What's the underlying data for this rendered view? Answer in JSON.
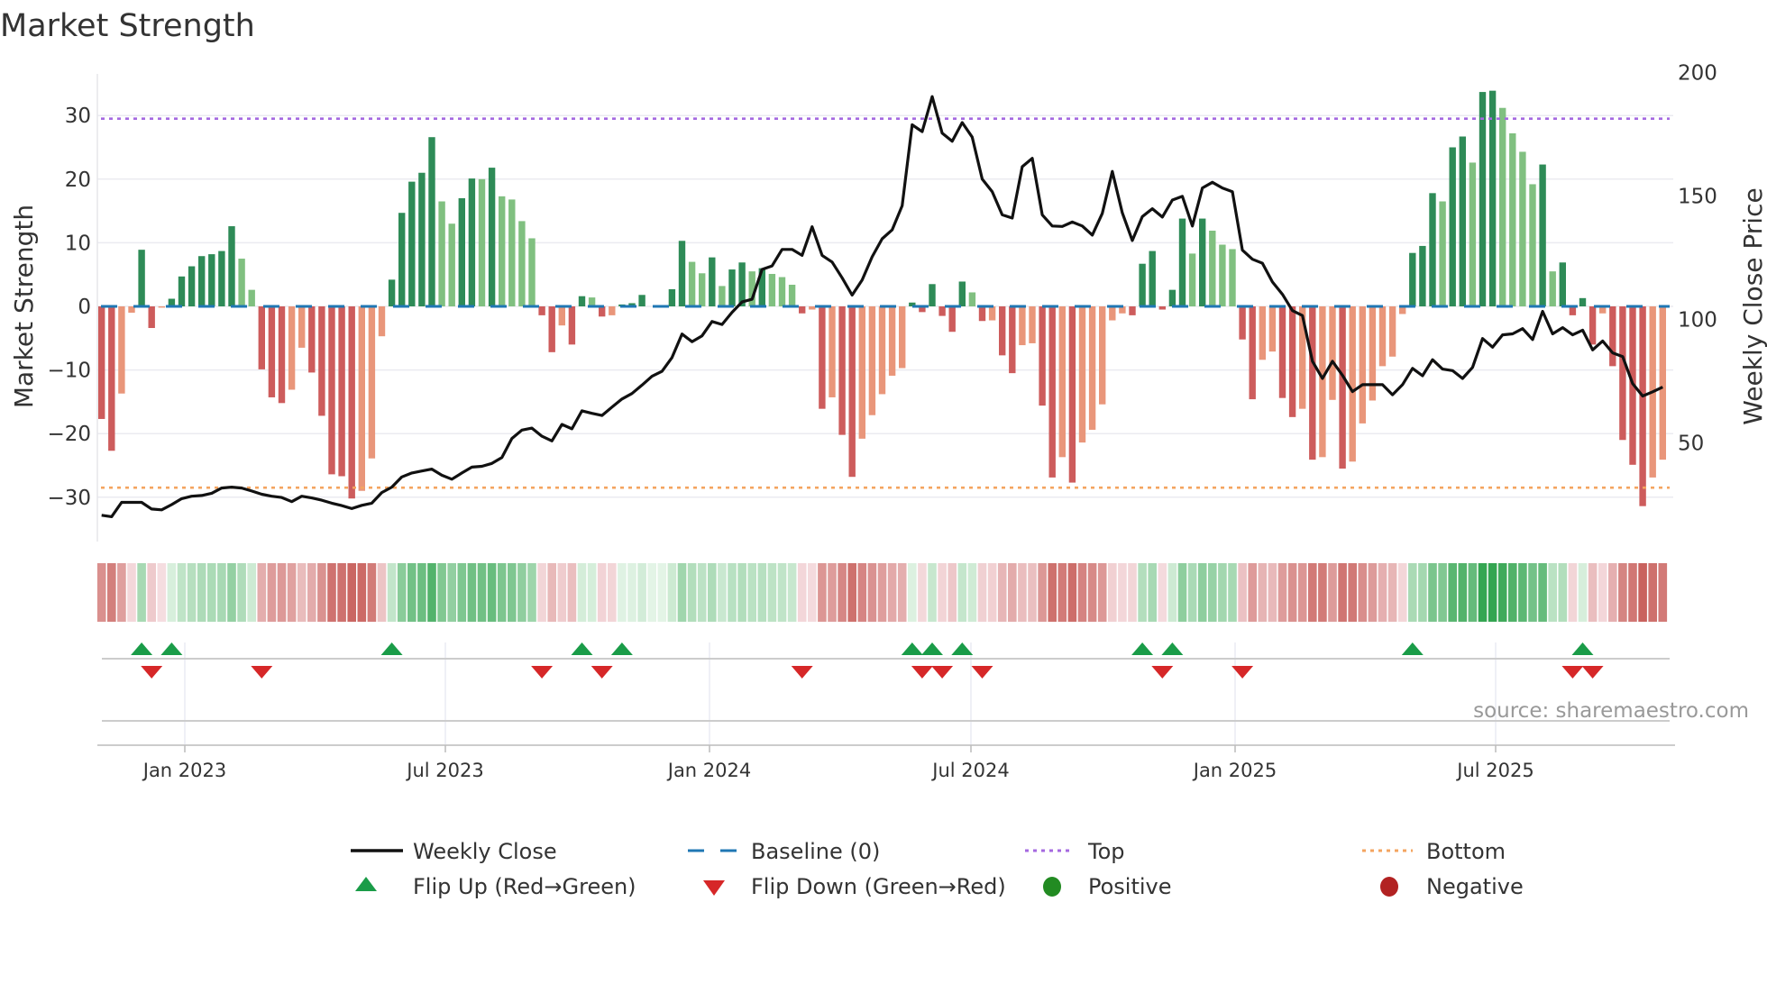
{
  "title": "Market Strength",
  "source": "source: sharemaestro.com",
  "colors": {
    "strong_green": "#2e8b57",
    "weak_green": "#80c080",
    "strong_red": "#cd5c5c",
    "weak_red": "#e9967a",
    "baseline": "#1f77b4",
    "top": "#a569e0",
    "bottom": "#f4a460",
    "flip_up": "#1a9c48",
    "flip_down": "#d62728",
    "positive": "#228b22",
    "negative": "#b22222",
    "price_line": "#111111"
  },
  "legend": [
    {
      "label": "Weekly Close",
      "icon": "solid-line"
    },
    {
      "label": "Baseline (0)",
      "icon": "dashed-line"
    },
    {
      "label": "Top",
      "icon": "dotted-line-purple"
    },
    {
      "label": "Bottom",
      "icon": "dotted-line-orange"
    },
    {
      "label": "Flip Up (Red→Green)",
      "icon": "triangle-up"
    },
    {
      "label": "Flip Down (Green→Red)",
      "icon": "triangle-down"
    },
    {
      "label": "Positive",
      "icon": "circle-green"
    },
    {
      "label": "Negative",
      "icon": "circle-red"
    }
  ],
  "chart_data": {
    "type": "bar+line",
    "title": "Market Strength",
    "frequency": "weekly",
    "left_axis": {
      "label": "Market Strength",
      "range": [
        -37,
        36.5
      ],
      "ticks": [
        30,
        20,
        10,
        0,
        -10,
        -20,
        -30
      ],
      "tick_labels": [
        "30",
        "20",
        "10",
        "0",
        "−10",
        "−20",
        "−30"
      ]
    },
    "right_axis": {
      "label": "Weekly Close Price",
      "range": [
        10,
        199.4
      ],
      "ticks": [
        200,
        150,
        100,
        50
      ],
      "tick_labels": [
        "200",
        "150",
        "100",
        "50"
      ]
    },
    "x_axis": {
      "tick_labels": [
        "Jan 2023",
        "Jul 2023",
        "Jan 2024",
        "Jul 2024",
        "Jan 2025",
        "Jul 2025"
      ]
    },
    "grid": true,
    "legend_position": "bottom",
    "top_line": 29.5,
    "bottom_line": -28.5,
    "baseline": 0,
    "strength": [
      -17.7,
      -22.7,
      -13.7,
      -1.0,
      8.9,
      -3.4,
      -0.2,
      1.2,
      4.7,
      6.3,
      7.9,
      8.2,
      8.7,
      12.6,
      7.5,
      2.6,
      -9.9,
      -14.3,
      -15.2,
      -13.1,
      -6.5,
      -10.4,
      -17.2,
      -26.4,
      -26.7,
      -30.2,
      -29.0,
      -23.9,
      -4.7,
      4.2,
      14.7,
      19.6,
      21.0,
      26.6,
      16.5,
      13.0,
      17.0,
      20.1,
      20.0,
      21.8,
      17.3,
      16.8,
      13.4,
      10.7,
      -1.4,
      -7.2,
      -3.0,
      -6.0,
      1.6,
      1.4,
      -1.6,
      -1.4,
      0.3,
      0.5,
      1.8,
      0,
      0,
      2.7,
      10.3,
      7.0,
      5.2,
      7.7,
      3.2,
      5.8,
      6.9,
      5.5,
      6.0,
      5.1,
      4.6,
      3.4,
      -1.1,
      -0.5,
      -16.1,
      -14.3,
      -20.2,
      -26.8,
      -20.8,
      -17.1,
      -13.8,
      -10.9,
      -9.7,
      0.6,
      -0.9,
      3.5,
      -1.5,
      -4.0,
      3.9,
      2.2,
      -2.3,
      -2.2,
      -7.7,
      -10.5,
      -6.1,
      -5.8,
      -15.6,
      -26.9,
      -23.7,
      -27.7,
      -21.4,
      -19.4,
      -15.4,
      -2.2,
      -1.1,
      -1.4,
      6.7,
      8.7,
      -0.5,
      2.6,
      13.8,
      8.3,
      13.8,
      11.9,
      9.7,
      9.0,
      -5.2,
      -14.6,
      -8.4,
      -7.1,
      -14.4,
      -17.4,
      -16.1,
      -24.1,
      -23.7,
      -14.7,
      -25.5,
      -24.4,
      -18.4,
      -14.8,
      -9.4,
      -7.9,
      -1.2,
      8.4,
      9.5,
      17.8,
      16.5,
      25.0,
      26.7,
      22.6,
      33.7,
      33.9,
      31.2,
      27.2,
      24.3,
      19.2,
      22.3,
      5.5,
      6.9,
      -1.4,
      1.3,
      -6.0,
      -1.1,
      -9.4,
      -21.0,
      -24.9,
      -31.4,
      -26.9,
      -24.1
    ],
    "weekly_close": [
      20.6,
      20.0,
      25.8,
      25.8,
      25.8,
      23.1,
      22.8,
      24.9,
      27.3,
      28.3,
      28.6,
      29.5,
      31.6,
      32.0,
      31.6,
      30.4,
      29.1,
      28.3,
      27.8,
      26.1,
      28.3,
      27.6,
      26.7,
      25.5,
      24.5,
      23.3,
      24.6,
      25.5,
      29.8,
      32.0,
      36.1,
      37.7,
      38.5,
      39.3,
      36.8,
      35.2,
      37.7,
      40.1,
      40.4,
      41.6,
      44.0,
      51.7,
      55.1,
      55.9,
      52.6,
      50.7,
      57.4,
      55.6,
      62.9,
      61.9,
      61.0,
      64.4,
      67.7,
      69.9,
      73.3,
      76.9,
      78.9,
      84.5,
      94.0,
      90.9,
      93.3,
      99.1,
      97.9,
      102.8,
      107.0,
      108.1,
      120.2,
      121.6,
      128.3,
      128.3,
      125.9,
      137.5,
      125.9,
      123.2,
      116.8,
      109.8,
      115.9,
      125.3,
      132.6,
      136.2,
      146.0,
      178.8,
      176.0,
      190.2,
      175.4,
      172.1,
      179.7,
      173.8,
      156.8,
      151.7,
      142.3,
      141.0,
      161.8,
      165.2,
      142.3,
      137.8,
      137.6,
      139.4,
      137.8,
      134.1,
      142.9,
      159.9,
      143.1,
      131.9,
      141.6,
      144.8,
      141.4,
      148.3,
      149.8,
      137.8,
      153.2,
      155.5,
      153.2,
      151.7,
      128.0,
      124.3,
      122.7,
      115.1,
      110.1,
      103.5,
      101.5,
      83.0,
      76.0,
      83.0,
      77.3,
      70.7,
      73.5,
      73.5,
      73.5,
      69.4,
      73.5,
      80.1,
      77.1,
      83.6,
      79.8,
      79.2,
      76.0,
      80.5,
      92.2,
      88.7,
      93.7,
      94.1,
      96.2,
      91.8,
      103.2,
      94.1,
      96.6,
      93.7,
      95.6,
      87.6,
      91.2,
      86.4,
      84.9,
      73.9,
      68.9,
      70.6,
      72.5
    ],
    "flip_up_weeks": [
      5,
      8,
      30,
      49,
      53,
      82,
      84,
      87,
      105,
      108,
      132,
      149
    ],
    "flip_down_weeks": [
      6,
      17,
      45,
      51,
      71,
      83,
      85,
      89,
      107,
      115,
      148,
      150
    ]
  }
}
